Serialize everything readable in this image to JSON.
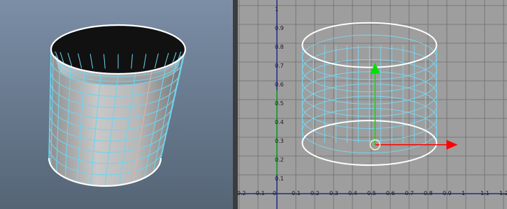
{
  "perspective_viewport": {
    "background_top": "#7b8ea6",
    "background_bottom": "#556576",
    "object": "cylinder",
    "wireframe_color": "#6fd3f0",
    "edge_color": "#ffffff"
  },
  "uv_editor": {
    "background": "#9e9e9e",
    "grid_color": "#6e6e6e",
    "uv_shell_color": "#79d9f6",
    "uv_border_color": "#ffffff",
    "axis_x_color": "#ff0000",
    "axis_y_color": "#00e000",
    "y_tick_labels": [
      "1",
      "0.9",
      "0.8",
      "0.7",
      "0.6",
      "0.5",
      "0.4",
      "0.3",
      "0.2",
      "0.1"
    ],
    "x_tick_labels": [
      "-0.2",
      "-0.1",
      "0",
      "0.1",
      "0.2",
      "0.3",
      "0.4",
      "0.5",
      "0.6",
      "0.7",
      "0.8",
      "0.9",
      "1",
      "1.1",
      "1.2"
    ]
  }
}
